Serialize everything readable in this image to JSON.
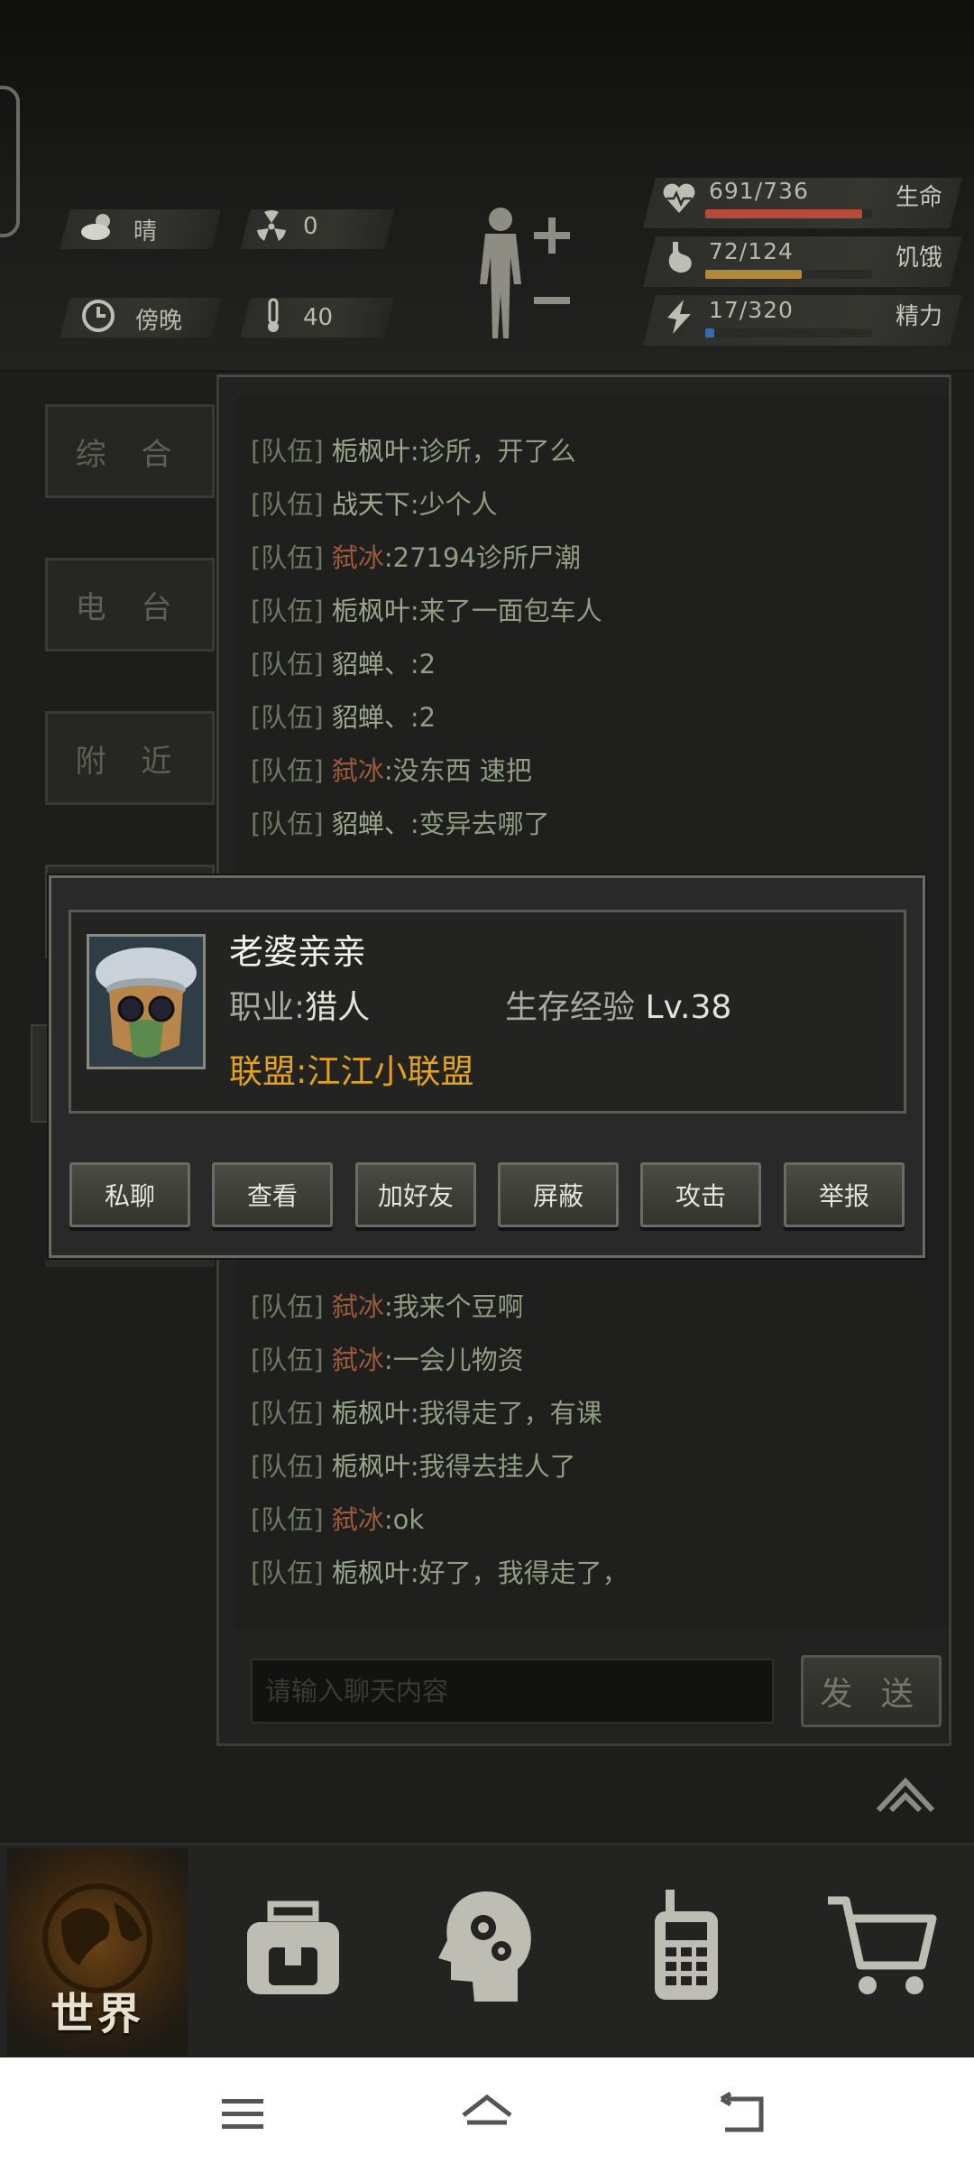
{
  "status": {
    "weather": "晴",
    "radiation": "0",
    "time_of_day": "傍晚",
    "temperature": "40"
  },
  "vitals": [
    {
      "value": "691/736",
      "label": "生命",
      "fraction": 0.939,
      "color": "#b84a3a",
      "icon": "heart-icon"
    },
    {
      "value": "72/124",
      "label": "饥饿",
      "fraction": 0.58,
      "color": "#b08a3a",
      "icon": "stomach-icon"
    },
    {
      "value": "17/320",
      "label": "精力",
      "fraction": 0.053,
      "color": "#3a6bb0",
      "icon": "energy-icon"
    }
  ],
  "side_tabs": [
    "综 合",
    "电 台",
    "附 近"
  ],
  "chat": {
    "rows": [
      {
        "tag": "[队伍]",
        "name": "栀枫叶",
        "msg": ":诊所，开了么",
        "orange": false
      },
      {
        "tag": "[队伍]",
        "name": "战天下",
        "msg": ":少个人",
        "orange": false
      },
      {
        "tag": "[队伍]",
        "name": "弑冰",
        "msg": ":27194诊所尸潮",
        "orange": true
      },
      {
        "tag": "[队伍]",
        "name": "栀枫叶",
        "msg": ":来了一面包车人",
        "orange": false
      },
      {
        "tag": "[队伍]",
        "name": "貂蝉、",
        "msg": ":2",
        "orange": false
      },
      {
        "tag": "[队伍]",
        "name": "貂蝉、",
        "msg": ":2",
        "orange": false
      },
      {
        "tag": "[队伍]",
        "name": "弑冰",
        "msg": ":没东西 速把",
        "orange": true
      },
      {
        "tag": "[队伍]",
        "name": "貂蝉、",
        "msg": ":变异去哪了",
        "orange": false
      },
      {
        "tag": "[队伍]",
        "name": "弑冰",
        "msg": ":我来个豆啊",
        "orange": true
      },
      {
        "tag": "[队伍]",
        "name": "弑冰",
        "msg": ":一会儿物资",
        "orange": true
      },
      {
        "tag": "[队伍]",
        "name": "栀枫叶",
        "msg": ":我得走了，有课",
        "orange": false
      },
      {
        "tag": "[队伍]",
        "name": "栀枫叶",
        "msg": ":我得去挂人了",
        "orange": false
      },
      {
        "tag": "[队伍]",
        "name": "弑冰",
        "msg": ":ok",
        "orange": true
      },
      {
        "tag": "[队伍]",
        "name": "栀枫叶",
        "msg": ":好了，我得走了，",
        "orange": false
      }
    ],
    "input_placeholder": "请输入聊天内容",
    "send_label": "发 送"
  },
  "popup": {
    "player_name": "老婆亲亲",
    "job_label": "职业:",
    "job_value": "猎人",
    "exp_label": "生存经验",
    "exp_value": "Lv.38",
    "alliance": "联盟:江江小联盟",
    "buttons": [
      "私聊",
      "查看",
      "加好友",
      "屏蔽",
      "攻击",
      "举报"
    ]
  },
  "nav": {
    "world_label": "世界",
    "items": [
      "backpack-icon",
      "skills-head-icon",
      "radio-icon",
      "shop-cart-icon"
    ]
  }
}
